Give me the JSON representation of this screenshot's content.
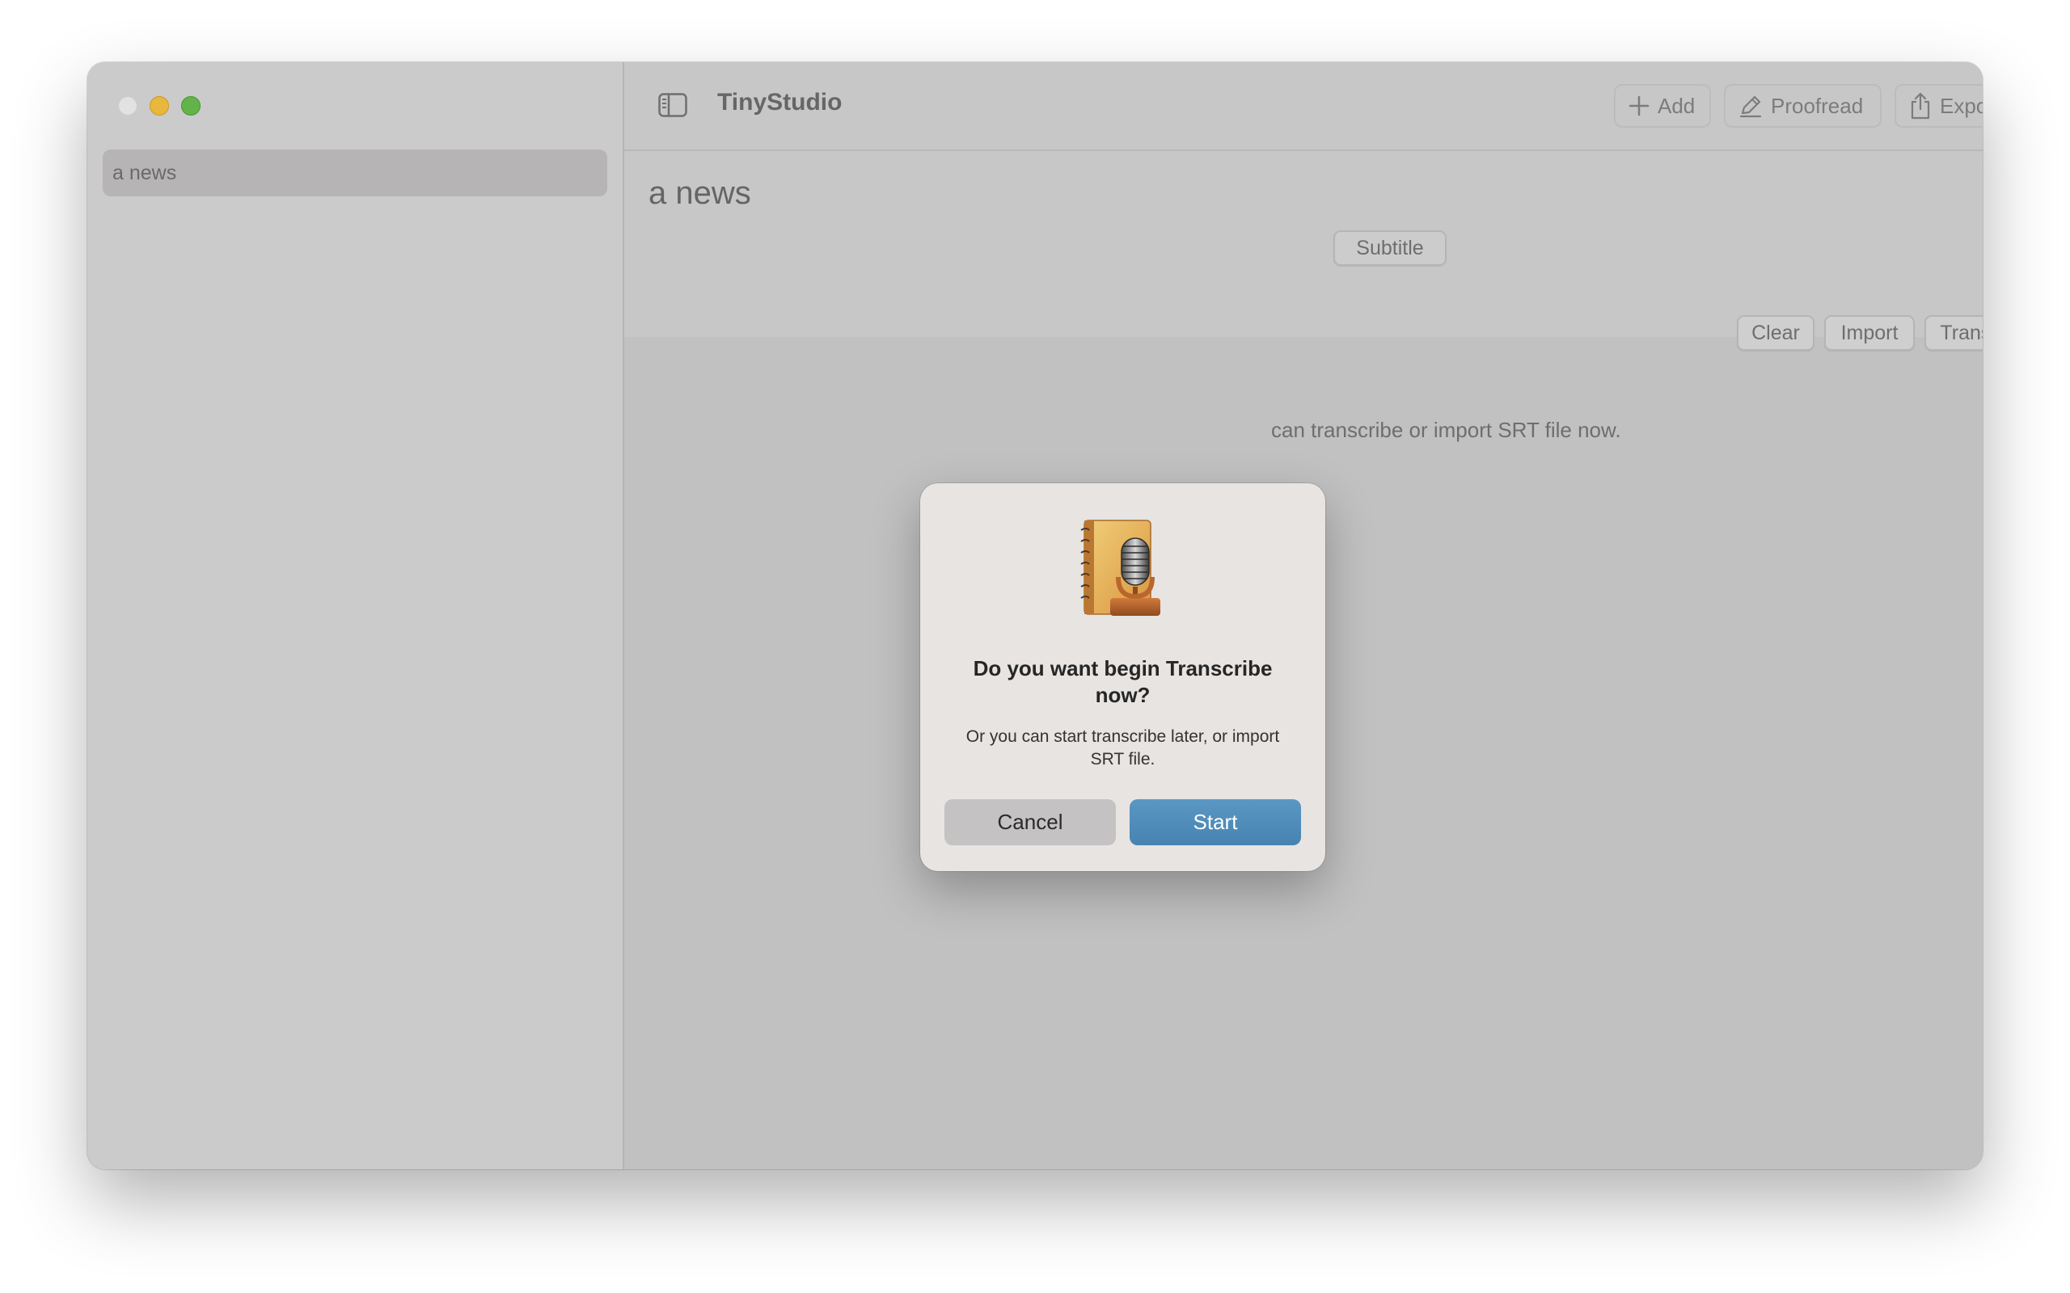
{
  "window": {
    "app_title": "TinyStudio"
  },
  "sidebar": {
    "items": [
      {
        "label": "a news",
        "selected": true
      }
    ]
  },
  "toolbar": {
    "add_label": "Add",
    "proofread_label": "Proofread",
    "export_label": "Export"
  },
  "document": {
    "title": "a news",
    "tab_label": "Subtitle",
    "actions": {
      "clear_label": "Clear",
      "import_label": "Import",
      "transcribe_label": "Transcribe"
    },
    "hint_text": "can transcribe or import SRT file now."
  },
  "dialog": {
    "icon": "microphone-notebook-icon",
    "title": "Do you want begin Transcribe now?",
    "message": "Or you can start transcribe later, or import SRT file.",
    "cancel_label": "Cancel",
    "start_label": "Start"
  },
  "colors": {
    "accent_button": "#4d8bb8",
    "traffic_close": "#e2e2e2",
    "traffic_minimize": "#e8b73e",
    "traffic_maximize": "#62b349"
  }
}
